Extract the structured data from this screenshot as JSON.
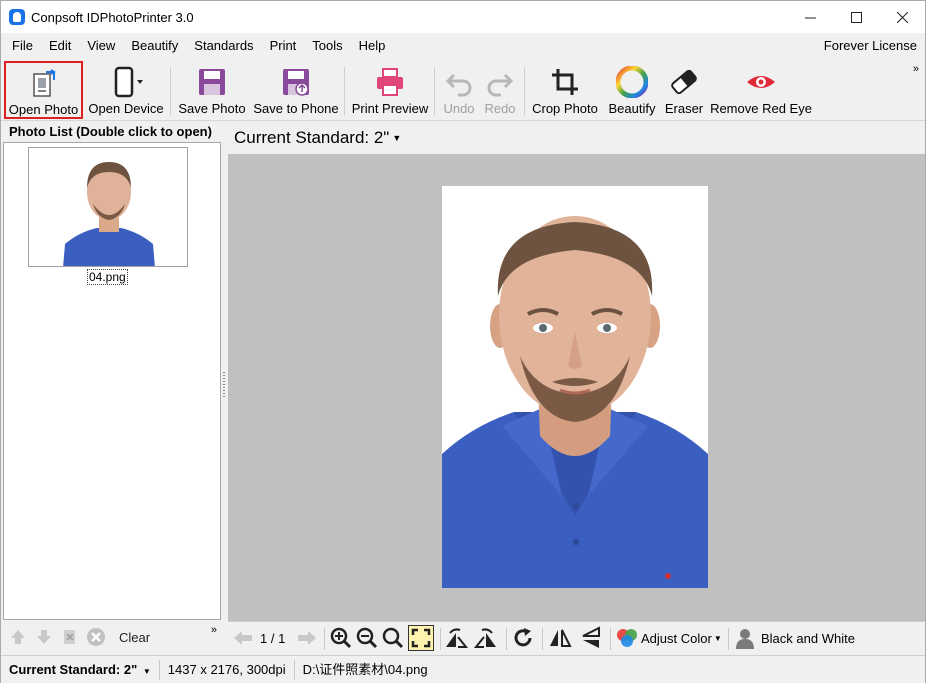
{
  "window": {
    "title": "Conpsoft IDPhotoPrinter 3.0",
    "minimize": "—",
    "maximize": "☐",
    "close": "✕"
  },
  "menu": {
    "items": [
      "File",
      "Edit",
      "View",
      "Beautify",
      "Standards",
      "Print",
      "Tools",
      "Help"
    ],
    "license": "Forever License"
  },
  "toolbar": {
    "open_photo": "Open Photo",
    "open_device": "Open Device",
    "save_photo": "Save Photo",
    "save_to_phone": "Save to Phone",
    "print_preview": "Print Preview",
    "undo": "Undo",
    "redo": "Redo",
    "crop_photo": "Crop Photo",
    "beautify": "Beautify",
    "eraser": "Eraser",
    "remove_red_eye": "Remove Red Eye",
    "more": "»"
  },
  "photo_list": {
    "header": "Photo List (Double click to open)",
    "items": [
      {
        "filename": "04.png"
      }
    ],
    "clear_label": "Clear",
    "more": "»"
  },
  "main": {
    "current_standard_label": "Current Standard: 2\"",
    "page_indicator": "1 / 1",
    "adjust_color": "Adjust Color",
    "black_and_white": "Black and White"
  },
  "status": {
    "standard": "Current Standard: 2\"",
    "info": "1437 x 2176, 300dpi",
    "path": "D:\\证件照素材\\04.png"
  },
  "colors": {
    "accent": "#1a73e8",
    "save_icon": "#8a4a9c",
    "print_icon": "#e0457b",
    "red_eye": "#e02a3a",
    "highlight_border": "#e02020",
    "shirt": "#3a5fc0",
    "canvas_bg": "#c0c0c0"
  }
}
